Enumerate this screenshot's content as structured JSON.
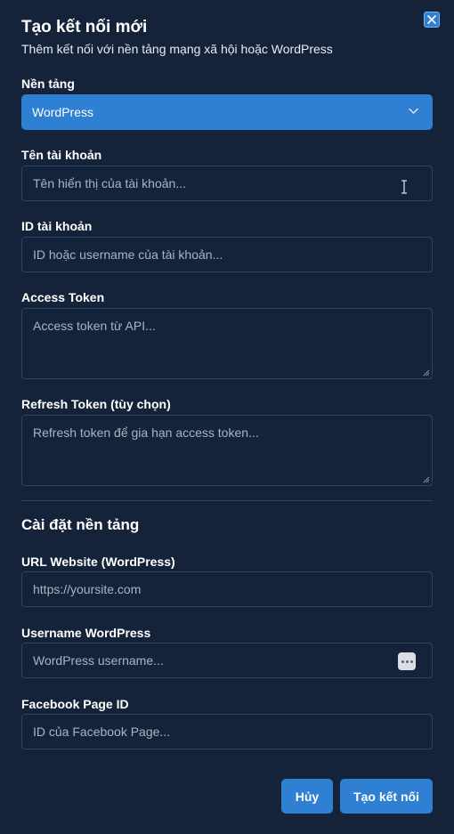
{
  "dialog": {
    "title": "Tạo kết nối mới",
    "subtitle": "Thêm kết nối với nền tảng mạng xã hội hoặc WordPress"
  },
  "icons": {
    "close": "close-icon",
    "chevron": "chevron-down-icon",
    "text_cursor": "text-cursor-icon",
    "password_manager": "password-manager-icon"
  },
  "platform": {
    "label": "Nền tảng",
    "selected": "WordPress"
  },
  "account_name": {
    "label": "Tên tài khoản",
    "placeholder": "Tên hiển thị của tài khoản..."
  },
  "account_id": {
    "label": "ID tài khoản",
    "placeholder": "ID hoặc username của tài khoản..."
  },
  "access_token": {
    "label": "Access Token",
    "placeholder": "Access token từ API..."
  },
  "refresh_token": {
    "label": "Refresh Token (tùy chọn)",
    "placeholder": "Refresh token để gia hạn access token..."
  },
  "settings": {
    "heading": "Cài đặt nền tảng",
    "website_url": {
      "label": "URL Website (WordPress)",
      "placeholder": "https://yoursite.com"
    },
    "wp_username": {
      "label": "Username WordPress",
      "placeholder": "WordPress username..."
    },
    "fb_page_id": {
      "label": "Facebook Page ID",
      "placeholder": "ID của Facebook Page..."
    }
  },
  "actions": {
    "cancel": "Hủy",
    "create": "Tạo kết nối"
  },
  "colors": {
    "background": "#15233a",
    "accent": "#2f7fd3",
    "border": "#2c4361",
    "placeholder": "#a9b4c3"
  }
}
